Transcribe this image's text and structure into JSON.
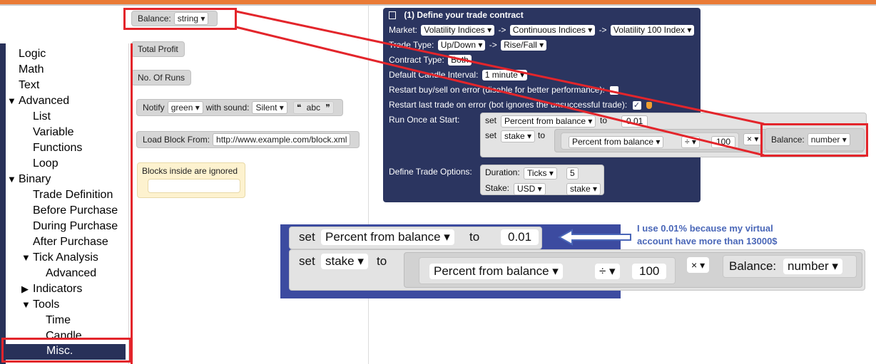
{
  "toolbox": {
    "items": [
      {
        "label": "Logic",
        "indent": 0,
        "tri": ""
      },
      {
        "label": "Math",
        "indent": 0,
        "tri": ""
      },
      {
        "label": "Text",
        "indent": 0,
        "tri": ""
      },
      {
        "label": "Advanced",
        "indent": 0,
        "tri": "▼"
      },
      {
        "label": "List",
        "indent": 1,
        "tri": ""
      },
      {
        "label": "Variable",
        "indent": 1,
        "tri": ""
      },
      {
        "label": "Functions",
        "indent": 1,
        "tri": ""
      },
      {
        "label": "Loop",
        "indent": 1,
        "tri": ""
      },
      {
        "label": "Binary",
        "indent": 0,
        "tri": "▼"
      },
      {
        "label": "Trade Definition",
        "indent": 1,
        "tri": ""
      },
      {
        "label": "Before Purchase",
        "indent": 1,
        "tri": ""
      },
      {
        "label": "During Purchase",
        "indent": 1,
        "tri": ""
      },
      {
        "label": "After Purchase",
        "indent": 1,
        "tri": ""
      },
      {
        "label": "Tick Analysis",
        "indent": 1,
        "tri": "▼"
      },
      {
        "label": "Advanced",
        "indent": 2,
        "tri": ""
      },
      {
        "label": "Indicators",
        "indent": 1,
        "tri": "▶"
      },
      {
        "label": "Tools",
        "indent": 1,
        "tri": "▼"
      },
      {
        "label": "Time",
        "indent": 2,
        "tri": ""
      },
      {
        "label": "Candle",
        "indent": 2,
        "tri": ""
      }
    ],
    "selected": "Misc."
  },
  "flyout": {
    "balance_label": "Balance:",
    "balance_type": "string ▾",
    "total_profit": "Total Profit",
    "no_of_runs": "No. Of Runs",
    "notify_label": "Notify",
    "notify_color": "green ▾",
    "with_sound": "with sound:",
    "sound": "Silent ▾",
    "quote_open": "❝",
    "text_value": "abc",
    "quote_close": "❞",
    "load_block_label": "Load Block From:",
    "load_block_url": "http://www.example.com/block.xml",
    "ignored_label": "Blocks inside are ignored"
  },
  "trade": {
    "title": "(1) Define your trade contract",
    "market_label": "Market:",
    "market_1": "Volatility Indices ▾",
    "arrow": "->",
    "market_2": "Continuous Indices ▾",
    "market_3": "Volatility 100 Index ▾",
    "trade_type_label": "Trade Type:",
    "trade_type_1": "Up/Down ▾",
    "trade_type_2": "Rise/Fall ▾",
    "contract_type_label": "Contract Type:",
    "contract_type": "Both",
    "candle_label": "Default Candle Interval:",
    "candle_value": "1 minute ▾",
    "restart_error": "Restart buy/sell on error  (disable for better performance):",
    "restart_last": "Restart last trade on error  (bot ignores the unsuccessful trade):",
    "run_once_label": "Run Once at Start:",
    "set": "set",
    "to": "to",
    "var_percent": "Percent from balance ▾",
    "value_001": "0.01",
    "var_stake": "stake ▾",
    "div_op": "÷ ▾",
    "value_100": "100",
    "mul_op": "× ▾",
    "balance_label": "Balance:",
    "balance_type": "number ▾",
    "trade_options_label": "Define Trade Options:",
    "duration_label": "Duration:",
    "duration_unit": "Ticks ▾",
    "duration_value": "5",
    "stake_label": "Stake:",
    "currency": "USD ▾",
    "stake_var": "stake ▾"
  },
  "zoom": {
    "set": "set",
    "to": "to",
    "var_percent": "Percent from balance ▾",
    "value_001": "0.01",
    "var_stake": "stake ▾",
    "var_percent_2": "Percent from balance ▾",
    "div_op": "÷ ▾",
    "value_100": "100",
    "mul_op": "× ▾",
    "balance_label": "Balance:",
    "balance_type": "number ▾"
  },
  "annotation": {
    "line1": "I use 0.01% because my virtual",
    "line2": "account have more than 13000$"
  },
  "colors": {
    "accent_orange": "#ea7b36",
    "navy": "#2b3560",
    "highlight_red": "#e3252b",
    "annotation_blue": "#4a67b8"
  }
}
